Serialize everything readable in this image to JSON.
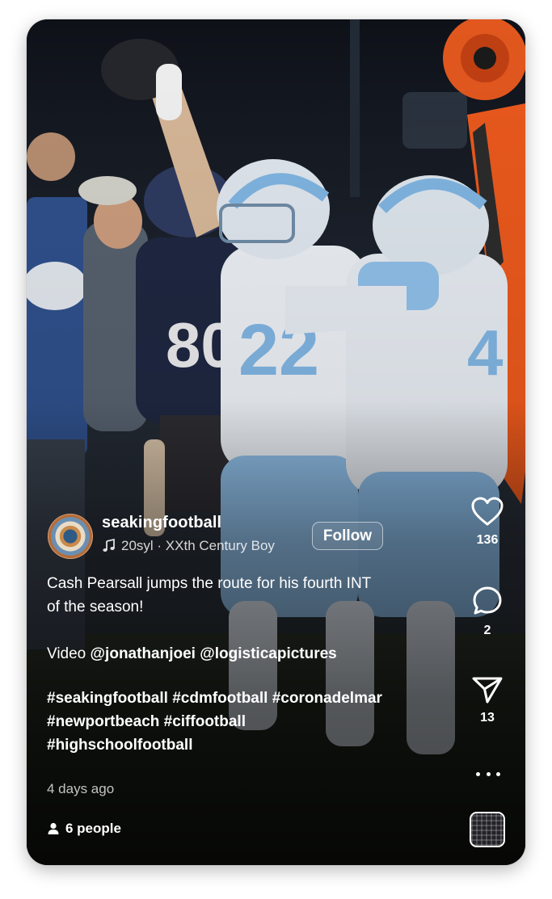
{
  "reel": {
    "username": "seakingfootball",
    "audio": "20syl · XXth Century Boy",
    "follow_label": "Follow",
    "caption": {
      "line1": "Cash Pearsall jumps the route for his fourth INT",
      "line2": "of the season!",
      "video_prefix": "Video ",
      "mention1": "@jonathanjoei",
      "mention2": "@logisticapictures",
      "hashtags_line1": "#seakingfootball #cdmfootball #coronadelmar",
      "hashtags_line2": "#newportbeach #ciffootball",
      "hashtags_line3": "#highschoolfootball"
    },
    "timestamp": "4 days ago",
    "people_count": "6 people",
    "image_jersey_numbers": [
      "22",
      "80"
    ]
  },
  "actions": {
    "likes": "136",
    "comments": "2",
    "shares": "13"
  },
  "icons": {
    "like": "heart-icon",
    "comment": "comment-bubble-icon",
    "share": "paper-plane-icon",
    "more": "more-dots-icon",
    "music": "music-note-icon",
    "people": "person-icon"
  },
  "colors": {
    "text": "#ffffff",
    "jersey_blue": "#7fb3e0",
    "opponent_navy": "#1e2740",
    "pylon_orange": "#e8581c"
  }
}
